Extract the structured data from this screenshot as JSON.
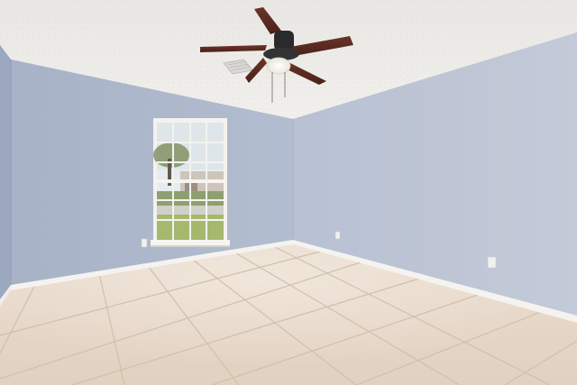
{
  "scene": {
    "kind": "photo",
    "subject": "empty-room",
    "colors": {
      "ceiling": "#eceae6",
      "ceiling_shadow": "#d9d7d3",
      "left_wall": "#aeb8cc",
      "back_wall": "#b6bfd1",
      "right_wall": "#bcc4d4",
      "far_left_wall": "#9aa6bd",
      "floor": "#e6d6c6",
      "floor_light": "#efe3d6",
      "grout": "#cbbba9",
      "baseboard": "#f4f3f0",
      "fan_blade": "#5a2c22",
      "fan_body": "#2a2a2c",
      "light": "#f6f4ea",
      "window_frame": "#f3f2ee",
      "window_sky": "#e8eef2",
      "window_grass": "#9bb16a",
      "window_house": "#c9c4bb",
      "outlet": "#f1f1ee"
    },
    "objects": [
      "ceiling-fan-icon",
      "window-icon",
      "air-vent-icon",
      "wall-outlet-icon",
      "tile-floor",
      "baseboard"
    ]
  }
}
